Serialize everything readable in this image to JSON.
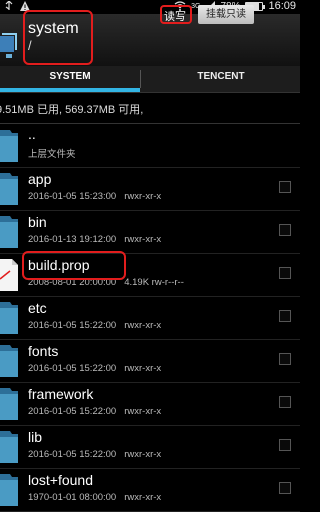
{
  "status_bar": {
    "battery": "78%",
    "time": "16:09",
    "network": "3G"
  },
  "header": {
    "title": "system",
    "path": "/"
  },
  "tabs": [
    {
      "label": "SYSTEM",
      "active": true
    },
    {
      "label": "TENCENT",
      "active": false
    }
  ],
  "info": {
    "storage": "9.51MB 已用, 569.37MB 可用,",
    "rw": "读写",
    "mount_button": "挂载只读"
  },
  "files": [
    {
      "name": "..",
      "meta": "上层文件夹",
      "perm": "",
      "type": "folder-up"
    },
    {
      "name": "app",
      "meta": "2016-01-05 15:23:00",
      "perm": "rwxr-xr-x",
      "type": "folder"
    },
    {
      "name": "bin",
      "meta": "2016-01-13 19:12:00",
      "perm": "rwxr-xr-x",
      "type": "folder"
    },
    {
      "name": "build.prop",
      "meta": "2008-08-01 20:00:00",
      "perm": "4.19K  rw-r--r--",
      "type": "file"
    },
    {
      "name": "etc",
      "meta": "2016-01-05 15:22:00",
      "perm": "rwxr-xr-x",
      "type": "folder"
    },
    {
      "name": "fonts",
      "meta": "2016-01-05 15:22:00",
      "perm": "rwxr-xr-x",
      "type": "folder"
    },
    {
      "name": "framework",
      "meta": "2016-01-05 15:22:00",
      "perm": "rwxr-xr-x",
      "type": "folder"
    },
    {
      "name": "lib",
      "meta": "2016-01-05 15:22:00",
      "perm": "rwxr-xr-x",
      "type": "folder"
    },
    {
      "name": "lost+found",
      "meta": "1970-01-01 08:00:00",
      "perm": "rwxr-xr-x",
      "type": "folder"
    }
  ],
  "colors": {
    "accent": "#33b5e5",
    "highlight": "#e21d1d",
    "folder": "#4a9bc4"
  }
}
